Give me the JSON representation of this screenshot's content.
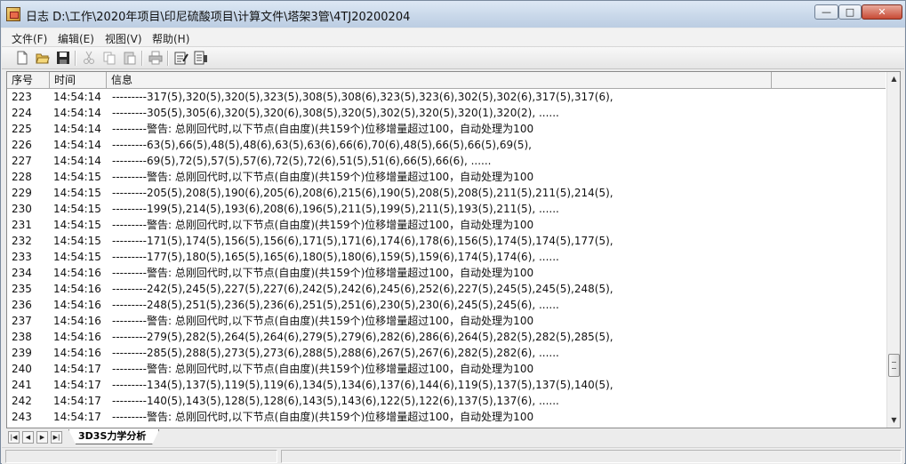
{
  "window": {
    "title": "日志  D:\\工作\\2020年项目\\印尼硫酸项目\\计算文件\\塔架3管\\4TJ20200204",
    "minimize_glyph": "—",
    "maximize_glyph": "□",
    "close_glyph": "✕"
  },
  "menu": {
    "file": "文件(F)",
    "edit": "编辑(E)",
    "view": "视图(V)",
    "help": "帮助(H)"
  },
  "toolbar": {
    "icons": [
      "new-file-icon",
      "open-folder-icon",
      "save-icon",
      "cut-icon",
      "copy-icon",
      "paste-icon",
      "print-icon",
      "edit-note-icon",
      "export-icon"
    ]
  },
  "table": {
    "columns": [
      "序号",
      "时间",
      "信息"
    ],
    "rows": [
      [
        "223",
        "14:54:14",
        "---------317(5),320(5),320(5),323(5),308(5),308(6),323(5),323(6),302(5),302(6),317(5),317(6),"
      ],
      [
        "224",
        "14:54:14",
        "---------305(5),305(6),320(5),320(6),308(5),320(5),302(5),320(5),320(1),320(2), ......"
      ],
      [
        "225",
        "14:54:14",
        "---------警告: 总刚回代时,以下节点(自由度)(共159个)位移增量超过100，自动处理为100"
      ],
      [
        "226",
        "14:54:14",
        "---------63(5),66(5),48(5),48(6),63(5),63(6),66(6),70(6),48(5),66(5),66(5),69(5),"
      ],
      [
        "227",
        "14:54:14",
        "---------69(5),72(5),57(5),57(6),72(5),72(6),51(5),51(6),66(5),66(6), ......"
      ],
      [
        "228",
        "14:54:15",
        "---------警告: 总刚回代时,以下节点(自由度)(共159个)位移增量超过100，自动处理为100"
      ],
      [
        "229",
        "14:54:15",
        "---------205(5),208(5),190(6),205(6),208(6),215(6),190(5),208(5),208(5),211(5),211(5),214(5),"
      ],
      [
        "230",
        "14:54:15",
        "---------199(5),214(5),193(6),208(6),196(5),211(5),199(5),211(5),193(5),211(5), ......"
      ],
      [
        "231",
        "14:54:15",
        "---------警告: 总刚回代时,以下节点(自由度)(共159个)位移增量超过100，自动处理为100"
      ],
      [
        "232",
        "14:54:15",
        "---------171(5),174(5),156(5),156(6),171(5),171(6),174(6),178(6),156(5),174(5),174(5),177(5),"
      ],
      [
        "233",
        "14:54:15",
        "---------177(5),180(5),165(5),165(6),180(5),180(6),159(5),159(6),174(5),174(6), ......"
      ],
      [
        "234",
        "14:54:16",
        "---------警告: 总刚回代时,以下节点(自由度)(共159个)位移增量超过100，自动处理为100"
      ],
      [
        "235",
        "14:54:16",
        "---------242(5),245(5),227(5),227(6),242(5),242(6),245(6),252(6),227(5),245(5),245(5),248(5),"
      ],
      [
        "236",
        "14:54:16",
        "---------248(5),251(5),236(5),236(6),251(5),251(6),230(5),230(6),245(5),245(6), ......"
      ],
      [
        "237",
        "14:54:16",
        "---------警告: 总刚回代时,以下节点(自由度)(共159个)位移增量超过100，自动处理为100"
      ],
      [
        "238",
        "14:54:16",
        "---------279(5),282(5),264(5),264(6),279(5),279(6),282(6),286(6),264(5),282(5),282(5),285(5),"
      ],
      [
        "239",
        "14:54:16",
        "---------285(5),288(5),273(5),273(6),288(5),288(6),267(5),267(6),282(5),282(6), ......"
      ],
      [
        "240",
        "14:54:17",
        "---------警告: 总刚回代时,以下节点(自由度)(共159个)位移增量超过100，自动处理为100"
      ],
      [
        "241",
        "14:54:17",
        "---------134(5),137(5),119(5),119(6),134(5),134(6),137(6),144(6),119(5),137(5),137(5),140(5),"
      ],
      [
        "242",
        "14:54:17",
        "---------140(5),143(5),128(5),128(6),143(5),143(6),122(5),122(6),137(5),137(6), ......"
      ],
      [
        "243",
        "14:54:17",
        "---------警告: 总刚回代时,以下节点(自由度)(共159个)位移增量超过100，自动处理为100"
      ]
    ]
  },
  "sheet_tab": {
    "label": "3D3S力学分析",
    "nav": [
      "|◀",
      "◀",
      "▶",
      "▶|"
    ]
  },
  "scrollbar": {
    "up_glyph": "▲",
    "down_glyph": "▼",
    "position_fraction": 0.88
  }
}
